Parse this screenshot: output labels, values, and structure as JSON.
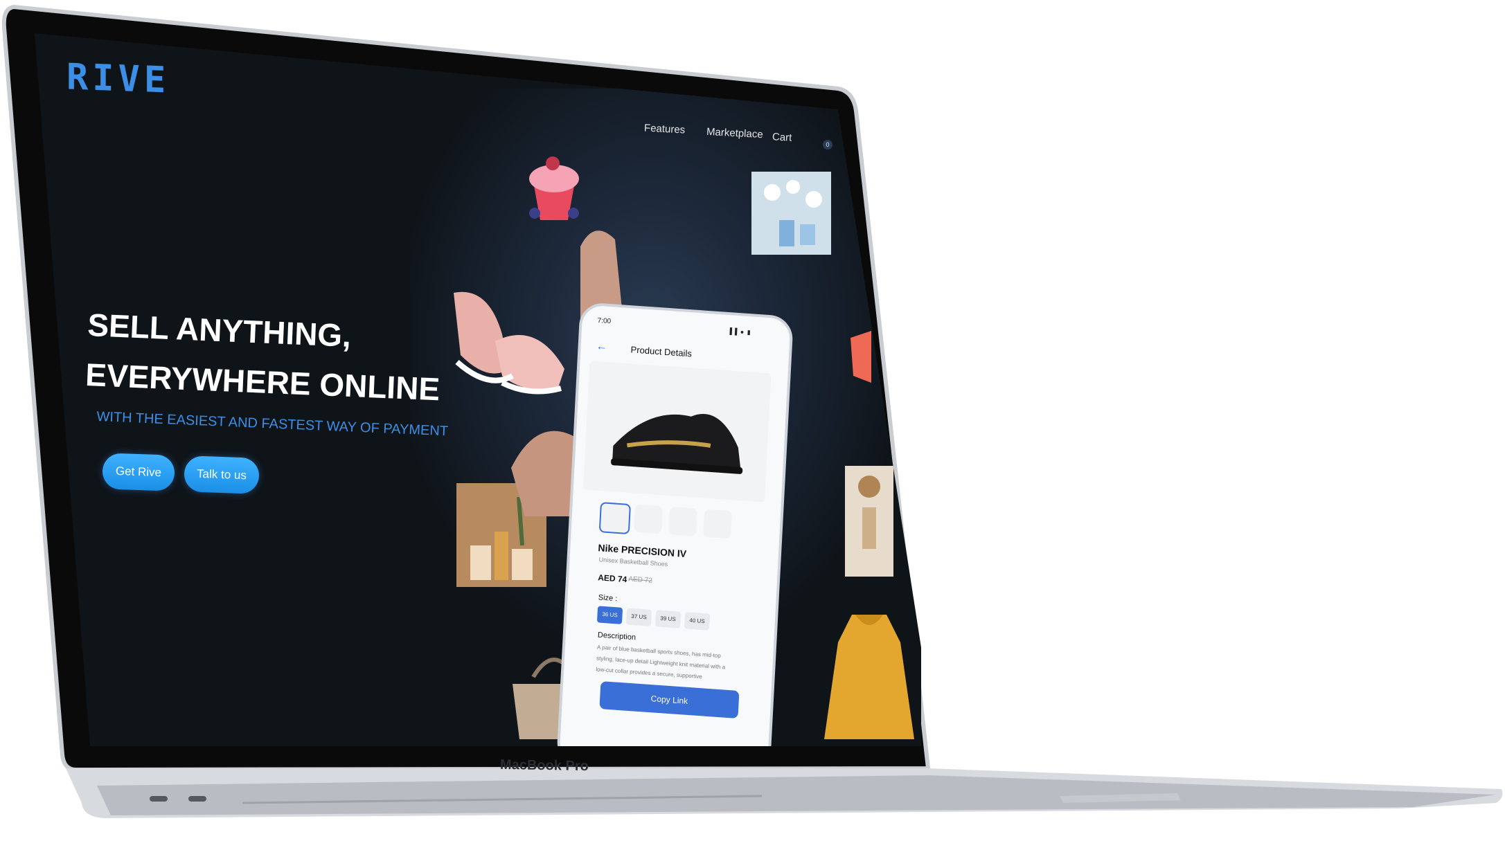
{
  "device": {
    "brand_label": "MacBook Pro"
  },
  "site": {
    "logo": "RIVE",
    "nav": {
      "features": "Features",
      "marketplace": "Marketplace",
      "cart": "Cart",
      "cart_count": "0"
    },
    "hero": {
      "title_line1": "SELL ANYTHING,",
      "title_line2": "EVERYWHERE ONLINE",
      "subtitle": "WITH THE EASIEST AND FASTEST WAY OF PAYMENT",
      "primary_button": "Get Rive",
      "secondary_button": "Talk to us"
    },
    "colors": {
      "background": "#0f1419",
      "accent": "#3b8fe6",
      "button": "#1a8fe6"
    }
  },
  "phone": {
    "time": "7:00",
    "status": "▐▐ ● ▮",
    "back_icon": "←",
    "title": "Product Details",
    "product_name": "Nike PRECISION IV",
    "category": "Unisex Basketball Shoes",
    "price": "AED 74",
    "old_price": "AED 72",
    "size_label": "Size :",
    "sizes": [
      "36 US",
      "37 US",
      "39 US",
      "40 US"
    ],
    "selected_size": "36 US",
    "description_label": "Description",
    "description": "A pair of blue basketball sports shoes, has mid-top styling, lace-up detail Lightweight knit material with a low-cut collar provides a secure, supportive",
    "copy_button": "Copy Link",
    "accent": "#3b6fd8"
  }
}
